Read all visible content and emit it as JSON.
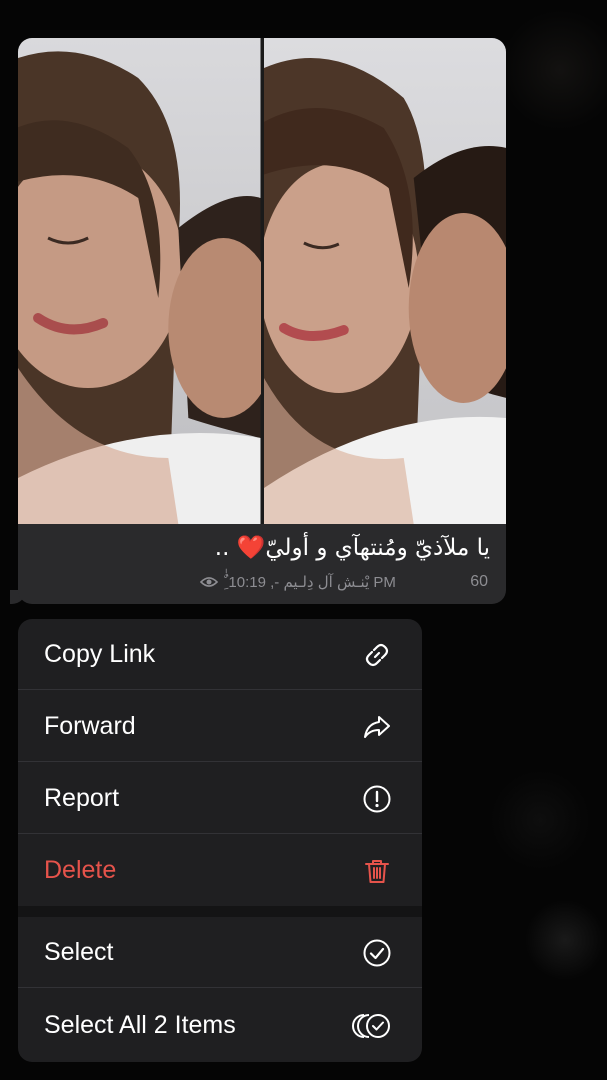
{
  "message": {
    "caption": "يا ملآذيّ ومُنتهآي و أوليّ❤️ ..",
    "meta_text": "ٌٰ ِيْنـش آل دِلـيم -, 10:19 PM",
    "views": "60",
    "photo_count": 2
  },
  "context_menu": {
    "items": [
      {
        "label": "Copy Link",
        "icon": "link-icon"
      },
      {
        "label": "Forward",
        "icon": "share-arrow-icon"
      },
      {
        "label": "Report",
        "icon": "exclamation-circle-icon"
      },
      {
        "label": "Delete",
        "icon": "trash-icon",
        "color": "#e5534b"
      },
      {
        "label": "Select",
        "icon": "checkmark-circle-icon"
      },
      {
        "label": "Select All 2 Items",
        "icon": "multi-select-icon"
      }
    ]
  },
  "colors": {
    "background": "#050505",
    "bubble": "#2a2a2c",
    "menu": "#1f1f21",
    "destructive": "#e5534b",
    "meta_text": "#8d8d92"
  }
}
